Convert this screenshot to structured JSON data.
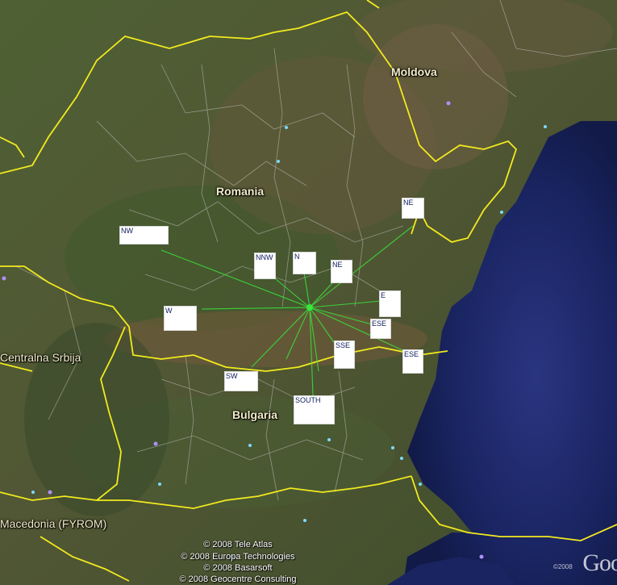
{
  "countries": {
    "moldova": "Moldova",
    "romania": "Romania",
    "serbia": "Centralna Srbija",
    "bulgaria": "Bulgaria",
    "macedonia": "Macedonia (FYROM)"
  },
  "markers": [
    {
      "id": "nw",
      "label": "NW"
    },
    {
      "id": "nnw",
      "label": "NNW"
    },
    {
      "id": "n",
      "label": "N"
    },
    {
      "id": "ne-near",
      "label": "NE"
    },
    {
      "id": "ne-far",
      "label": "NE"
    },
    {
      "id": "e",
      "label": "E"
    },
    {
      "id": "w",
      "label": "W"
    },
    {
      "id": "ese-near",
      "label": "ESE"
    },
    {
      "id": "ese-far",
      "label": "ESE"
    },
    {
      "id": "sse",
      "label": "SSE"
    },
    {
      "id": "sw",
      "label": "SW"
    },
    {
      "id": "south",
      "label": "SOUTH"
    }
  ],
  "copyright": [
    "© 2008 Tele Atlas",
    "© 2008 Europa Technologies",
    "© 2008 Basarsoft",
    "© 2008 Geocentre Consulting"
  ],
  "logo": {
    "text": "Goo",
    "year": "©2008"
  },
  "colors": {
    "border": "#f2ea1e",
    "ray": "#39e63a",
    "sea": "#1a2460",
    "land": "#4a5a34"
  }
}
